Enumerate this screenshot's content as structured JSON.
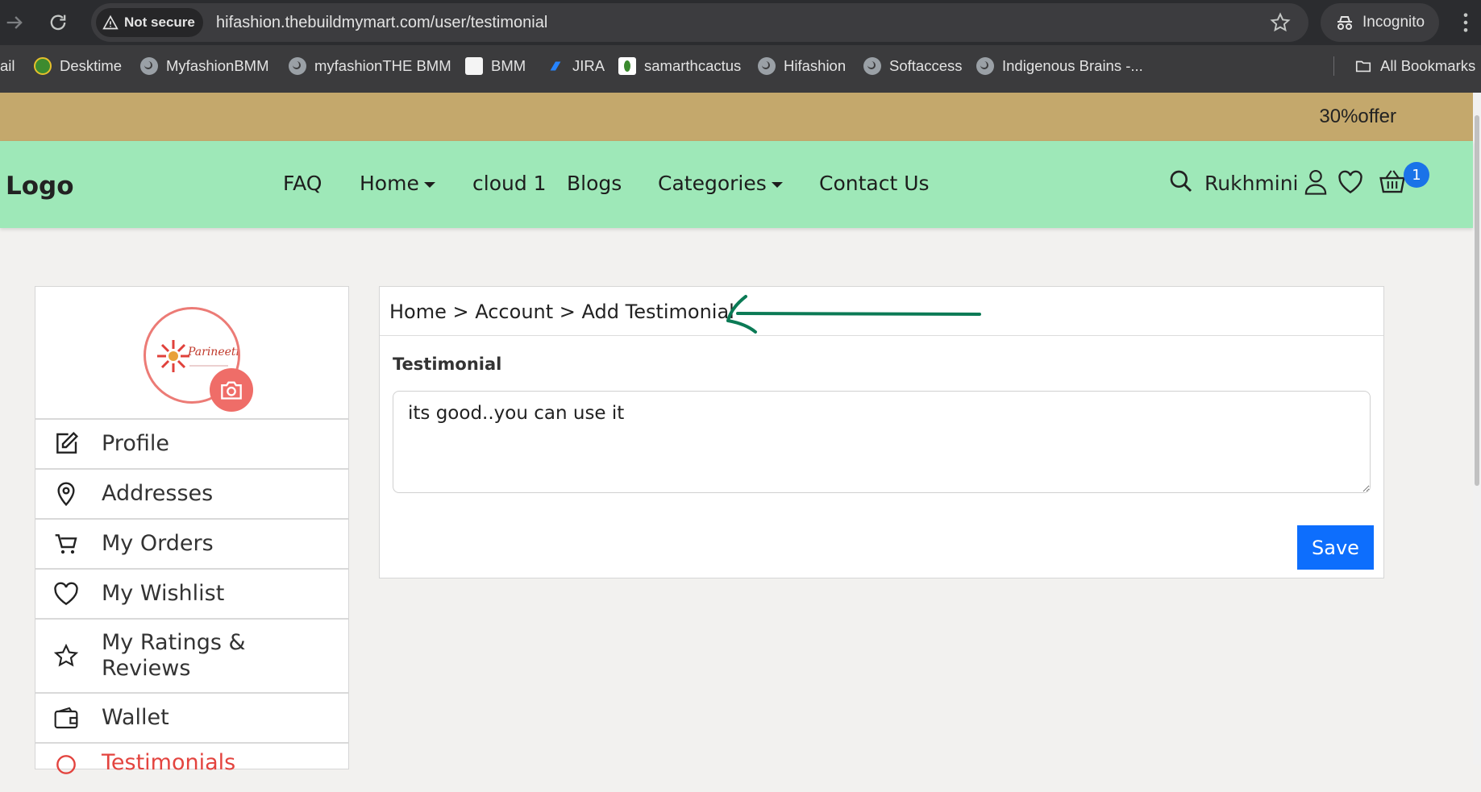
{
  "browser": {
    "security_label": "Not secure",
    "url": "hifashion.thebuildmymart.com/user/testimonial",
    "incognito_label": "Incognito"
  },
  "bookmarks": {
    "items": [
      {
        "label": "ail",
        "icon": "none"
      },
      {
        "label": "Desktime",
        "icon": "desktime-icon"
      },
      {
        "label": "MyfashionBMM",
        "icon": "globe-icon"
      },
      {
        "label": "myfashionTHE BMM",
        "icon": "globe-icon"
      },
      {
        "label": "BMM",
        "icon": "bmm-icon"
      },
      {
        "label": "JIRA",
        "icon": "jira-icon"
      },
      {
        "label": "samarthcactus",
        "icon": "cactus-icon"
      },
      {
        "label": "Hifashion",
        "icon": "globe-icon"
      },
      {
        "label": "Softaccess",
        "icon": "globe-icon"
      },
      {
        "label": "Indigenous Brains -...",
        "icon": "globe-icon"
      }
    ],
    "all_bookmarks": "All Bookmarks"
  },
  "offer": {
    "text": "30%offer"
  },
  "header": {
    "logo": "Logo",
    "nav": {
      "faq": "FAQ",
      "home": "Home",
      "cloud": "cloud 1",
      "blogs": "Blogs",
      "categories": "Categories",
      "contact": "Contact Us"
    },
    "user_name": "Rukhmini",
    "cart_count": "1"
  },
  "sidebar": {
    "avatar_brand": "Parineeti",
    "items": [
      {
        "label": "Profile",
        "icon": "edit-icon"
      },
      {
        "label": "Addresses",
        "icon": "location-pin-icon"
      },
      {
        "label": "My Orders",
        "icon": "cart-icon"
      },
      {
        "label": "My Wishlist",
        "icon": "heart-icon"
      },
      {
        "label": "My Ratings & Reviews",
        "icon": "star-icon"
      },
      {
        "label": "Wallet",
        "icon": "wallet-icon"
      },
      {
        "label": "Testimonials",
        "icon": "testimonial-icon"
      }
    ]
  },
  "main": {
    "breadcrumb": "Home > Account > Add Testimonial",
    "field_label": "Testimonial",
    "testimonial_value": "its good..you can use it",
    "save_label": "Save"
  },
  "colors": {
    "offer_bar": "#c4a86c",
    "header_bg": "#9ee8b8",
    "accent_blue": "#0d6efd",
    "avatar_ring": "#ec7b76",
    "annotation_green": "#0b7a55"
  }
}
